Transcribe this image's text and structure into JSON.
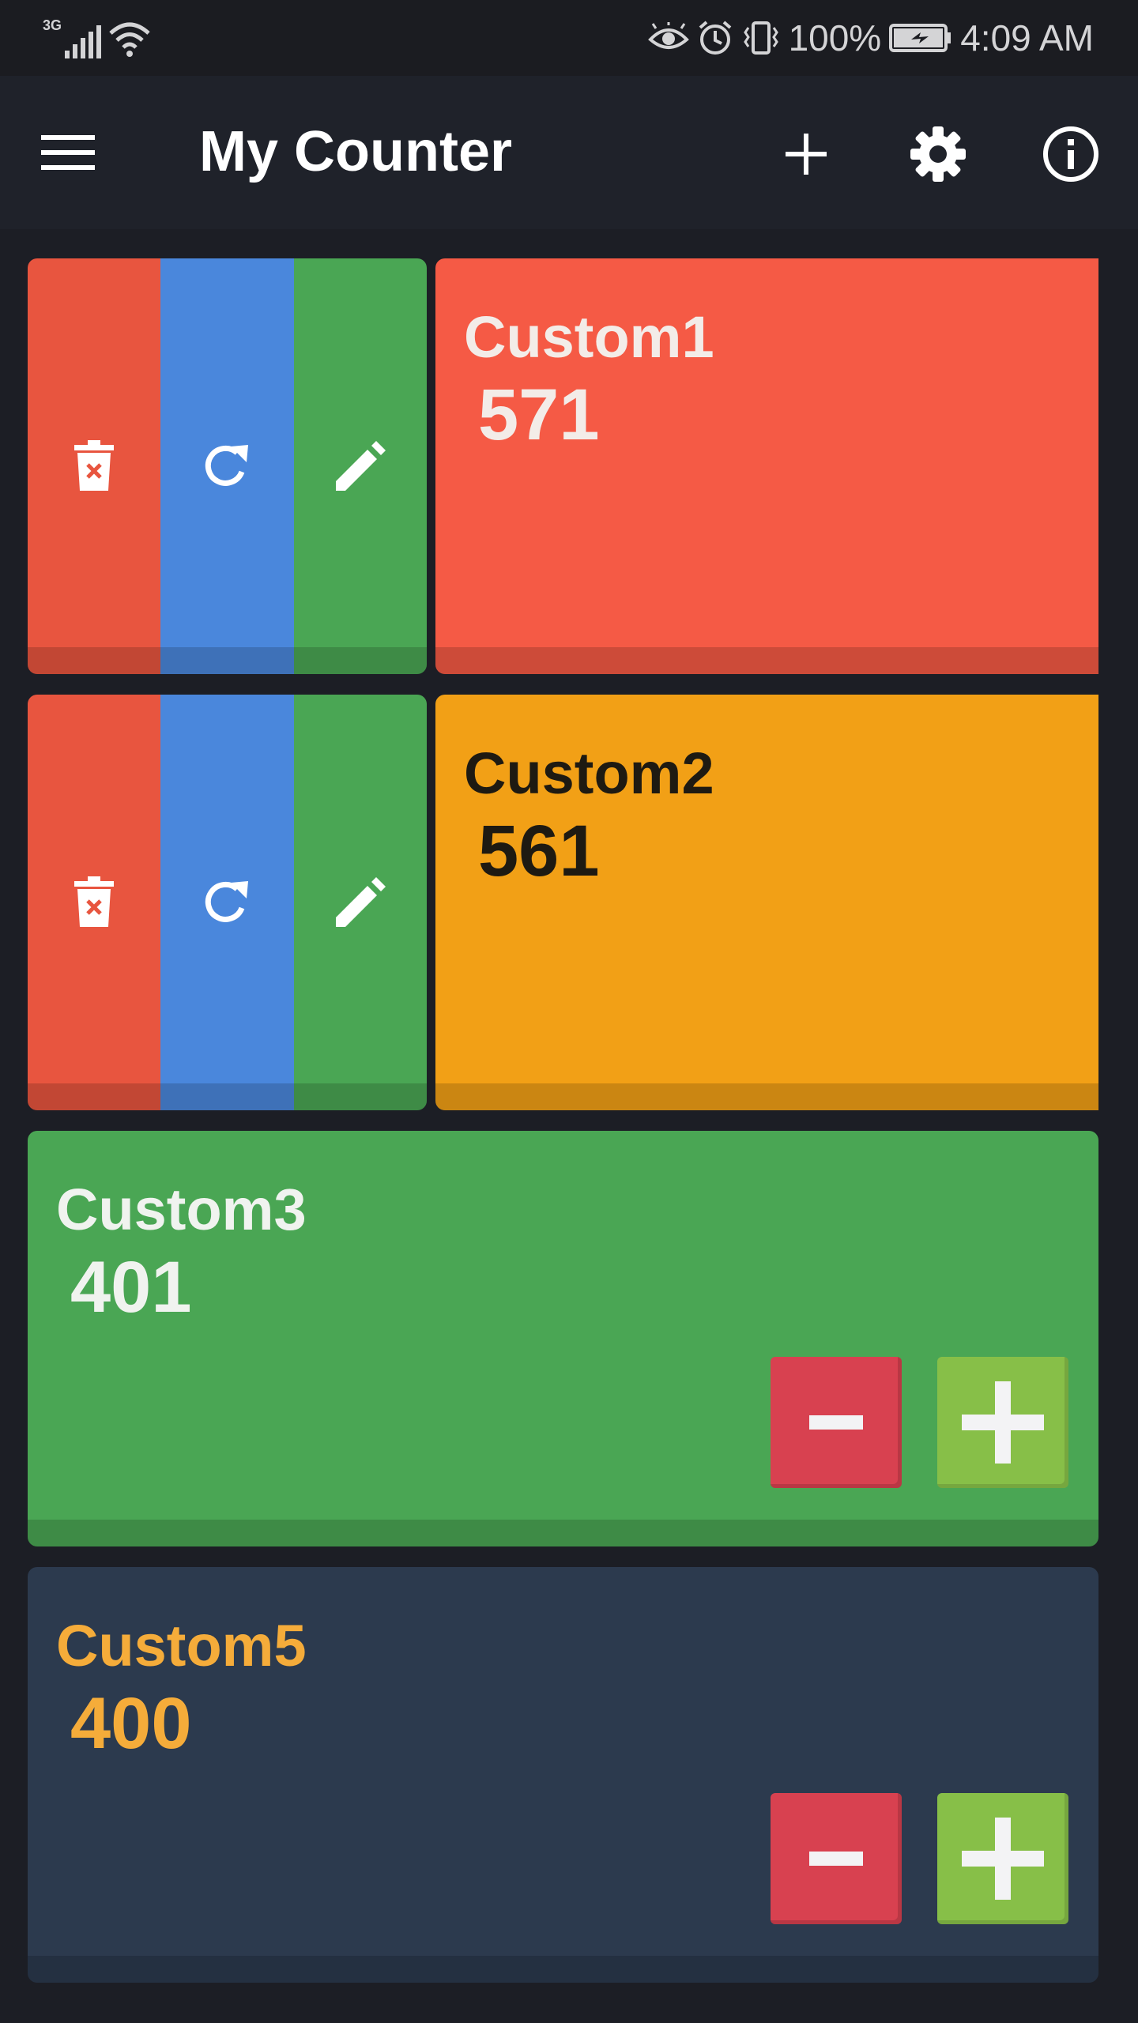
{
  "status_bar": {
    "network": "3G",
    "battery": "100%",
    "time": "4:09 AM"
  },
  "app_bar": {
    "title": "My Counter",
    "icons": [
      "menu-icon",
      "plus-icon",
      "gear-icon",
      "info-icon"
    ]
  },
  "counters": [
    {
      "name": "Custom1",
      "value": "571",
      "color": "#f55a45",
      "text_color": "#f3ece8",
      "layout": "swiped"
    },
    {
      "name": "Custom2",
      "value": "561",
      "color": "#f2a016",
      "text_color": "#1e1a12",
      "layout": "swiped"
    },
    {
      "name": "Custom3",
      "value": "401",
      "color": "#4aa654",
      "text_color": "#f0f3ef",
      "layout": "full"
    },
    {
      "name": "Custom5",
      "value": "400",
      "color": "#2c3a4e",
      "text_color": "#f5ac3a",
      "layout": "full"
    }
  ],
  "action_colors": {
    "delete": "#e8553f",
    "reset": "#4a87dc",
    "edit": "#4aa654"
  },
  "button_colors": {
    "minus": "#d84150",
    "plus": "#87bf48"
  },
  "action_icons": [
    "trash-icon",
    "refresh-icon",
    "pencil-icon"
  ]
}
